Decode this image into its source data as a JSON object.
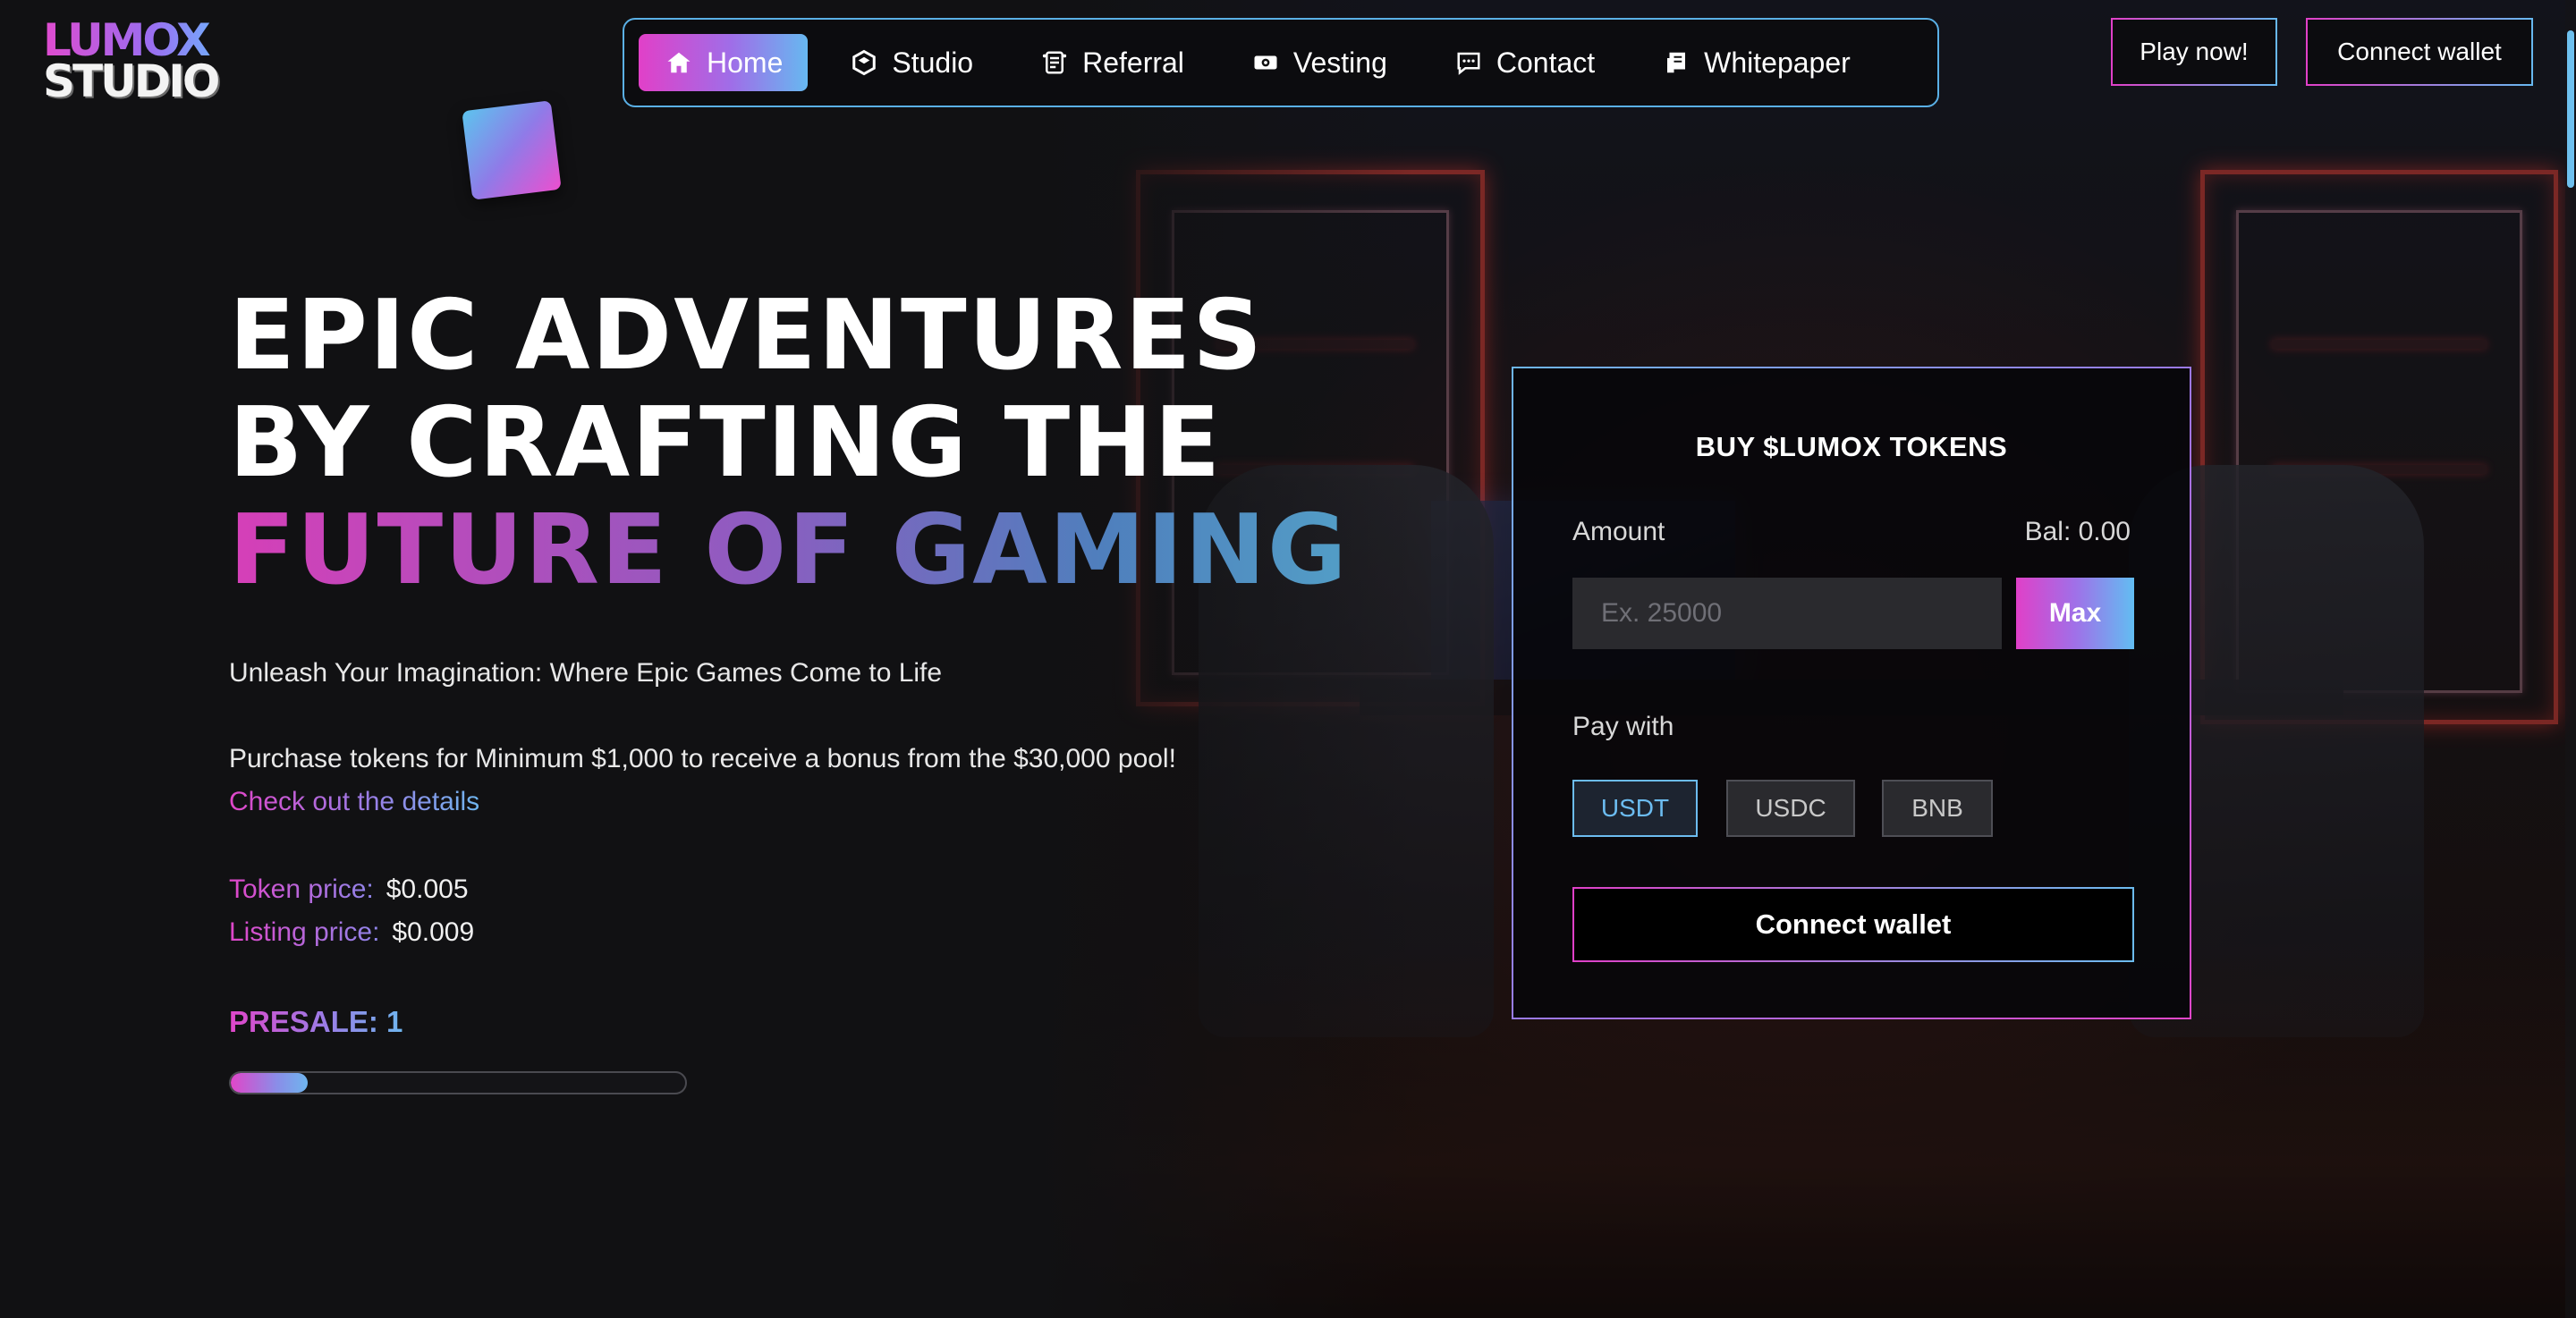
{
  "brand": {
    "logo_top": "LUMOX",
    "logo_bottom": "STUDIO"
  },
  "nav": {
    "items": [
      {
        "label": "Home",
        "icon": "home-icon",
        "active": true
      },
      {
        "label": "Studio",
        "icon": "cube-icon",
        "active": false
      },
      {
        "label": "Referral",
        "icon": "referral-icon",
        "active": false
      },
      {
        "label": "Vesting",
        "icon": "vesting-icon",
        "active": false
      },
      {
        "label": "Contact",
        "icon": "chat-icon",
        "active": false
      },
      {
        "label": "Whitepaper",
        "icon": "document-icon",
        "active": false
      }
    ]
  },
  "header": {
    "play_label": "Play now!",
    "connect_label": "Connect wallet"
  },
  "hero": {
    "title_line1": "EPIC ADVENTURES",
    "title_line2": "BY CRAFTING THE",
    "title_line3": "FUTURE OF GAMING",
    "tagline": "Unleash Your Imagination: Where Epic Games Come to Life",
    "purchase_text": "Purchase tokens for Minimum $1,000 to receive a bonus from the $30,000 pool!",
    "details_link": "Check out the details",
    "token_price_label": "Token price:",
    "token_price_value": "$0.005",
    "listing_price_label": "Listing price:",
    "listing_price_value": "$0.009",
    "presale_label": "PRESALE: 1",
    "presale_progress_fraction": 0.17
  },
  "buy_panel": {
    "title": "BUY $LUMOX TOKENS",
    "amount_label": "Amount",
    "balance": "Bal: 0.00",
    "amount_placeholder": "Ex. 25000",
    "amount_value": "",
    "max_label": "Max",
    "pay_with_label": "Pay with",
    "currencies": [
      {
        "label": "USDT",
        "selected": true
      },
      {
        "label": "USDC",
        "selected": false
      },
      {
        "label": "BNB",
        "selected": false
      }
    ],
    "connect_label": "Connect wallet"
  },
  "colors": {
    "accent_pink": "#e040c8",
    "accent_purple": "#9b7ce6",
    "accent_blue": "#6cbcf0",
    "background": "#111113"
  }
}
